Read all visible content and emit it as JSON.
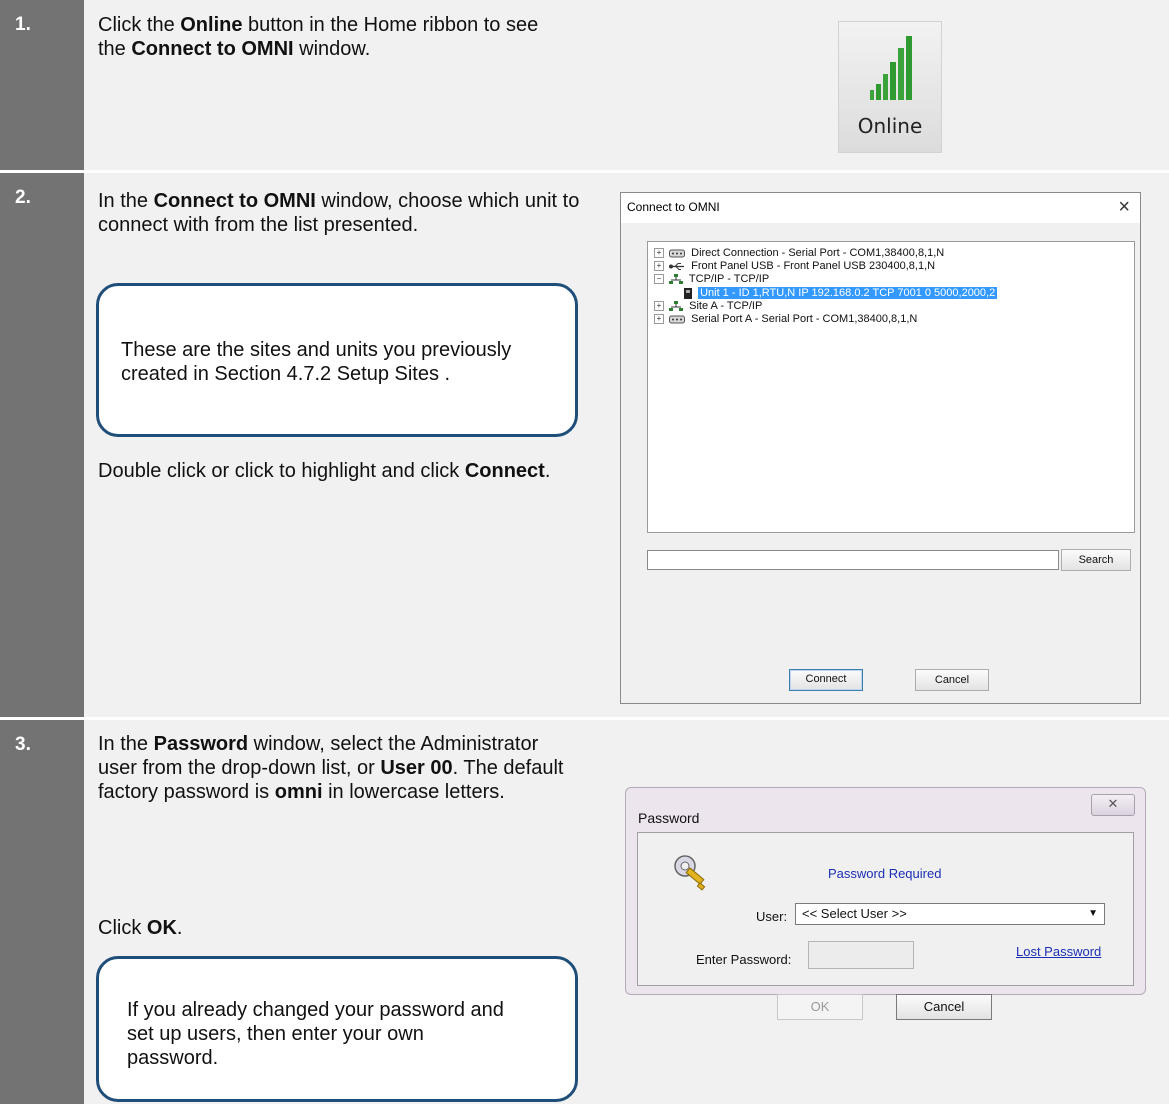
{
  "steps": [
    {
      "number": "1.",
      "text": [
        {
          "t": "Click the "
        },
        {
          "b": "Online"
        },
        {
          "t": " button in the Home ribbon to see the "
        },
        {
          "b": "Connect to OMNI"
        },
        {
          "t": " window."
        }
      ],
      "button_label": "Online"
    },
    {
      "number": "2.",
      "text": [
        {
          "t": "In the "
        },
        {
          "b": "Connect to OMNI"
        },
        {
          "t": " window, choose which unit to connect with from the list presented."
        }
      ],
      "callout": "These are the sites and units you previously created in Section 4.7.2 Setup Sites .",
      "after": [
        {
          "t": "Double click or click to highlight and click "
        },
        {
          "b": "Connect"
        },
        {
          "t": "."
        }
      ]
    },
    {
      "number": "3.",
      "text": [
        {
          "t": "In the "
        },
        {
          "b": "Password"
        },
        {
          "t": " window, select the Administrator user from the drop-down list, or "
        },
        {
          "b": "User 00"
        },
        {
          "t": ". The default factory password is "
        },
        {
          "b": "omni"
        },
        {
          "t": " in lowercase letters."
        }
      ],
      "after": [
        {
          "t": "Click "
        },
        {
          "b": "OK"
        },
        {
          "t": "."
        }
      ],
      "callout": "If you already changed your password and set up users, then enter your own password."
    }
  ],
  "connect_window": {
    "title": "Connect to OMNI",
    "close": "×",
    "tree": [
      {
        "expander": "+",
        "icon": "serial-port-icon",
        "label": "Direct Connection - Serial Port - COM1,38400,8,1,N"
      },
      {
        "expander": "+",
        "icon": "usb-icon",
        "label": "Front Panel USB - Front Panel USB  230400,8,1,N"
      },
      {
        "expander": "−",
        "icon": "network-icon",
        "label": "TCP/IP - TCP/IP"
      },
      {
        "expander": "",
        "icon": "unit-icon",
        "label": "Unit 1 - ID 1,RTU,N  IP 192.168.0.2 TCP 7001  0  5000,2000,2",
        "selected": true
      },
      {
        "expander": "+",
        "icon": "network-icon",
        "label": "Site A - TCP/IP"
      },
      {
        "expander": "+",
        "icon": "serial-port-icon",
        "label": "Serial Port A - Serial Port - COM1,38400,8,1,N"
      }
    ],
    "search_value": "",
    "search_label": "Search",
    "connect_label": "Connect",
    "cancel_label": "Cancel"
  },
  "password_window": {
    "title": "Password",
    "close": "✕",
    "required_text": "Password Required",
    "user_label": "User:",
    "user_selected": "<< Select User >>",
    "enter_password_label": "Enter Password:",
    "password_value": "",
    "lost_password_label": "Lost Password",
    "ok_label": "OK",
    "cancel_label": "Cancel"
  },
  "colors": {
    "step_number_bg": "#737373",
    "row_bg": "#f1f1f1",
    "callout_border": "#1f4e79",
    "signal_green": "#3aa43a",
    "selection": "#3399ff",
    "link_blue": "#1a2fb5"
  }
}
